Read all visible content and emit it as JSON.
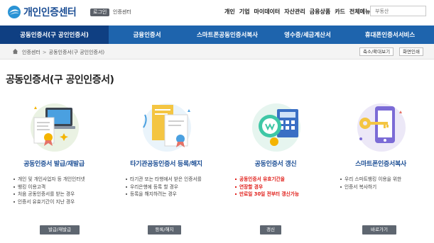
{
  "header": {
    "logo_text": "개인인증센터",
    "login_label": "로그인",
    "center_label": "인증센터",
    "nav": [
      "개인",
      "기업",
      "마이데이터",
      "자산관리",
      "금융상품",
      "카드",
      "전체메뉴"
    ],
    "search_placeholder": "부동산"
  },
  "main_nav": {
    "items": [
      {
        "label": "공동인증서(구 공인인증서)",
        "active": true
      },
      {
        "label": "금융인증서",
        "active": false
      },
      {
        "label": "스마트폰공동인증서복사",
        "active": false
      },
      {
        "label": "영수증/세금계산서",
        "active": false
      },
      {
        "label": "휴대폰인증서서비스",
        "active": false
      }
    ]
  },
  "breadcrumb": {
    "items": [
      "인증센터",
      "공동인증서(구 공인인증서)"
    ],
    "zoom_label": "축소/확대보기",
    "print_label": "화면인쇄"
  },
  "page": {
    "title": "공동인증서(구 공인인증서)"
  },
  "cards": [
    {
      "title": "공동인증서 발급/재발급",
      "desc": [
        "개인 및 개인사업자 등 개인인터넷",
        "뱅킹 이용고객",
        "처음 공동인증서를 받는 경우",
        "인증서 유효기간이 지난 경우"
      ],
      "button": "발급/재발급"
    },
    {
      "title": "타기관공동인증서 등록/해지",
      "desc": [
        "타기관 또는 타행에서 받은 인증서를",
        "우리은행에 등록 할 경우",
        "등록을 해지하려는 경우"
      ],
      "button": "등록/해지"
    },
    {
      "title": "공동인증서 갱신",
      "desc": [
        "공동인증서 유효기간을",
        "연장할 경우",
        "만료일 30일 전부터 갱신가능"
      ],
      "button": "갱신"
    },
    {
      "title": "스마트폰인증서복사",
      "desc": [
        "우리 스마트뱅킹 이용을 위한",
        "인증서 복사하기"
      ],
      "button": "바로가기"
    }
  ],
  "colors": {
    "brand_blue": "#1e64ad",
    "nav_active": "#0f3f82",
    "title_blue": "#1d4f95",
    "highlight_red": "#e0201b"
  }
}
